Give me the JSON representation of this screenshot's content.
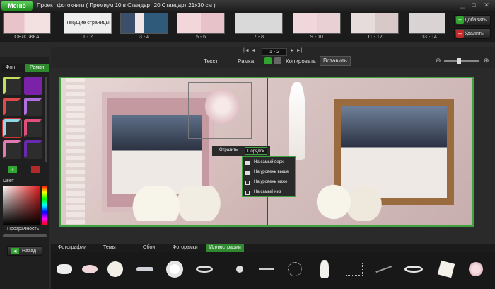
{
  "titlebar": {
    "menu": "Меню",
    "title": "Проект фотокниги ( Премиум 10 в Стандарт 20 Стандарт 21x30 см )"
  },
  "strip": {
    "pages": [
      "ОБЛОЖКА",
      "1 - 2",
      "3 - 4",
      "5 - 6",
      "7 - 8",
      "9 - 10",
      "11 - 12",
      "13 - 14"
    ],
    "current_pages_label": "Текущие страницы",
    "add": "Добавить",
    "delete": "Удалить"
  },
  "leftpanel": {
    "tabs": [
      "Фон",
      "Рамки"
    ],
    "color_label": "Цвет",
    "transparency_label": "Прозрачность",
    "back": "Назад"
  },
  "toolbar": {
    "page_indicator": "1 - 2",
    "text": "Текст",
    "frame": "Рамка",
    "copy": "Копировать",
    "paste": "Вставить"
  },
  "context": {
    "reflect": "Отразить",
    "order": "Порядок",
    "items": [
      "На самый верх",
      "На уровень выше",
      "На уровень ниже",
      "На самый низ"
    ]
  },
  "bottom": {
    "tabs": [
      "Фотографии",
      "Темы",
      "Обои",
      "Фоторамки",
      "Иллюстрации"
    ]
  }
}
